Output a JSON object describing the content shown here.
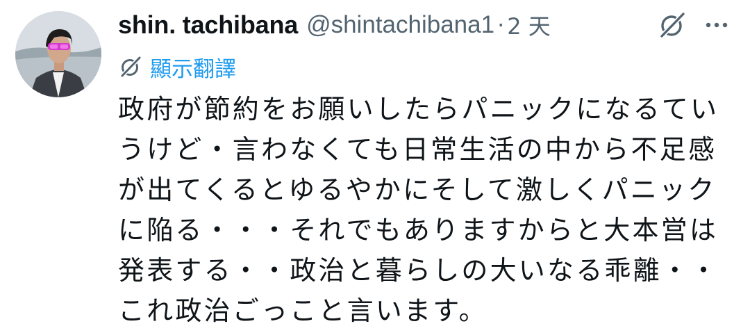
{
  "tweet": {
    "display_name": "shin. tachibana",
    "handle": "@shintachibana1",
    "separator": "·",
    "time": "2 天",
    "translate_label": "顯示翻譯",
    "lines": [
      "政府が節約をお願いしたらパニックになるてい",
      "うけど・言わなくても日常生活の中から不足感",
      "が出てくるとゆるやかにそして激しくパニック",
      "に陥る・・・それでもありますからと大本営は",
      "発表する・・政治と暮らしの大いなる乖離・・",
      "これ政治ごっこと言います。"
    ]
  },
  "icons": {
    "avatar": "profile-photo",
    "grok": "grok-icon",
    "more": "more-dots-icon",
    "translate": "grok-translate-icon"
  },
  "colors": {
    "text": "#0f1419",
    "muted": "#536471",
    "link": "#1d9bf0",
    "background": "#ffffff"
  }
}
